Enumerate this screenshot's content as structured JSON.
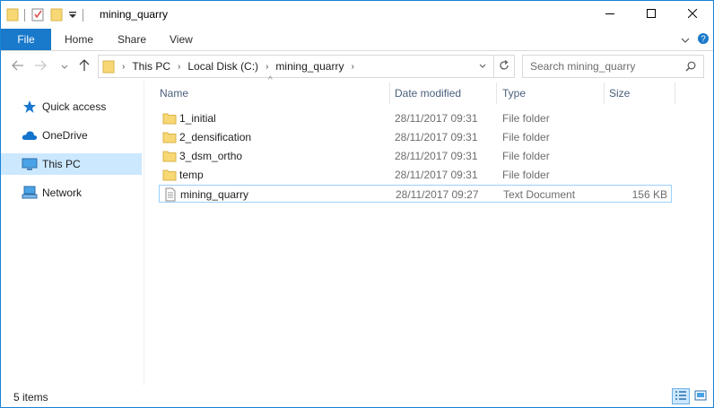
{
  "window": {
    "title": "mining_quarry",
    "controls": {
      "minimize": "—",
      "maximize": "☐",
      "close": "✕"
    }
  },
  "ribbon": {
    "tabs": [
      "File",
      "Home",
      "Share",
      "View"
    ],
    "chevron": "⌄",
    "help": "?"
  },
  "address": {
    "crumbs": [
      "This PC",
      "Local Disk (C:)",
      "mining_quarry"
    ],
    "search_placeholder": "Search mining_quarry"
  },
  "navpane": {
    "items": [
      {
        "label": "Quick access",
        "icon": "star-icon",
        "selected": false
      },
      {
        "label": "OneDrive",
        "icon": "cloud-icon",
        "selected": false
      },
      {
        "label": "This PC",
        "icon": "computer-icon",
        "selected": true
      },
      {
        "label": "Network",
        "icon": "network-icon",
        "selected": false
      }
    ]
  },
  "filelist": {
    "columns": {
      "name": "Name",
      "date": "Date modified",
      "type": "Type",
      "size": "Size"
    },
    "sort_indicator": "^",
    "rows": [
      {
        "name": "1_initial",
        "date": "28/11/2017 09:31",
        "type": "File folder",
        "size": "",
        "icon": "folder-icon"
      },
      {
        "name": "2_densification",
        "date": "28/11/2017 09:31",
        "type": "File folder",
        "size": "",
        "icon": "folder-icon"
      },
      {
        "name": "3_dsm_ortho",
        "date": "28/11/2017 09:31",
        "type": "File folder",
        "size": "",
        "icon": "folder-icon"
      },
      {
        "name": "temp",
        "date": "28/11/2017 09:31",
        "type": "File folder",
        "size": "",
        "icon": "folder-icon"
      },
      {
        "name": "mining_quarry",
        "date": "28/11/2017 09:27",
        "type": "Text Document",
        "size": "156 KB",
        "icon": "text-document-icon"
      }
    ]
  },
  "status": {
    "item_count": "5 items"
  },
  "colors": {
    "accent": "#1979ca",
    "folder": "#f8d775",
    "selection": "#cce8ff"
  }
}
